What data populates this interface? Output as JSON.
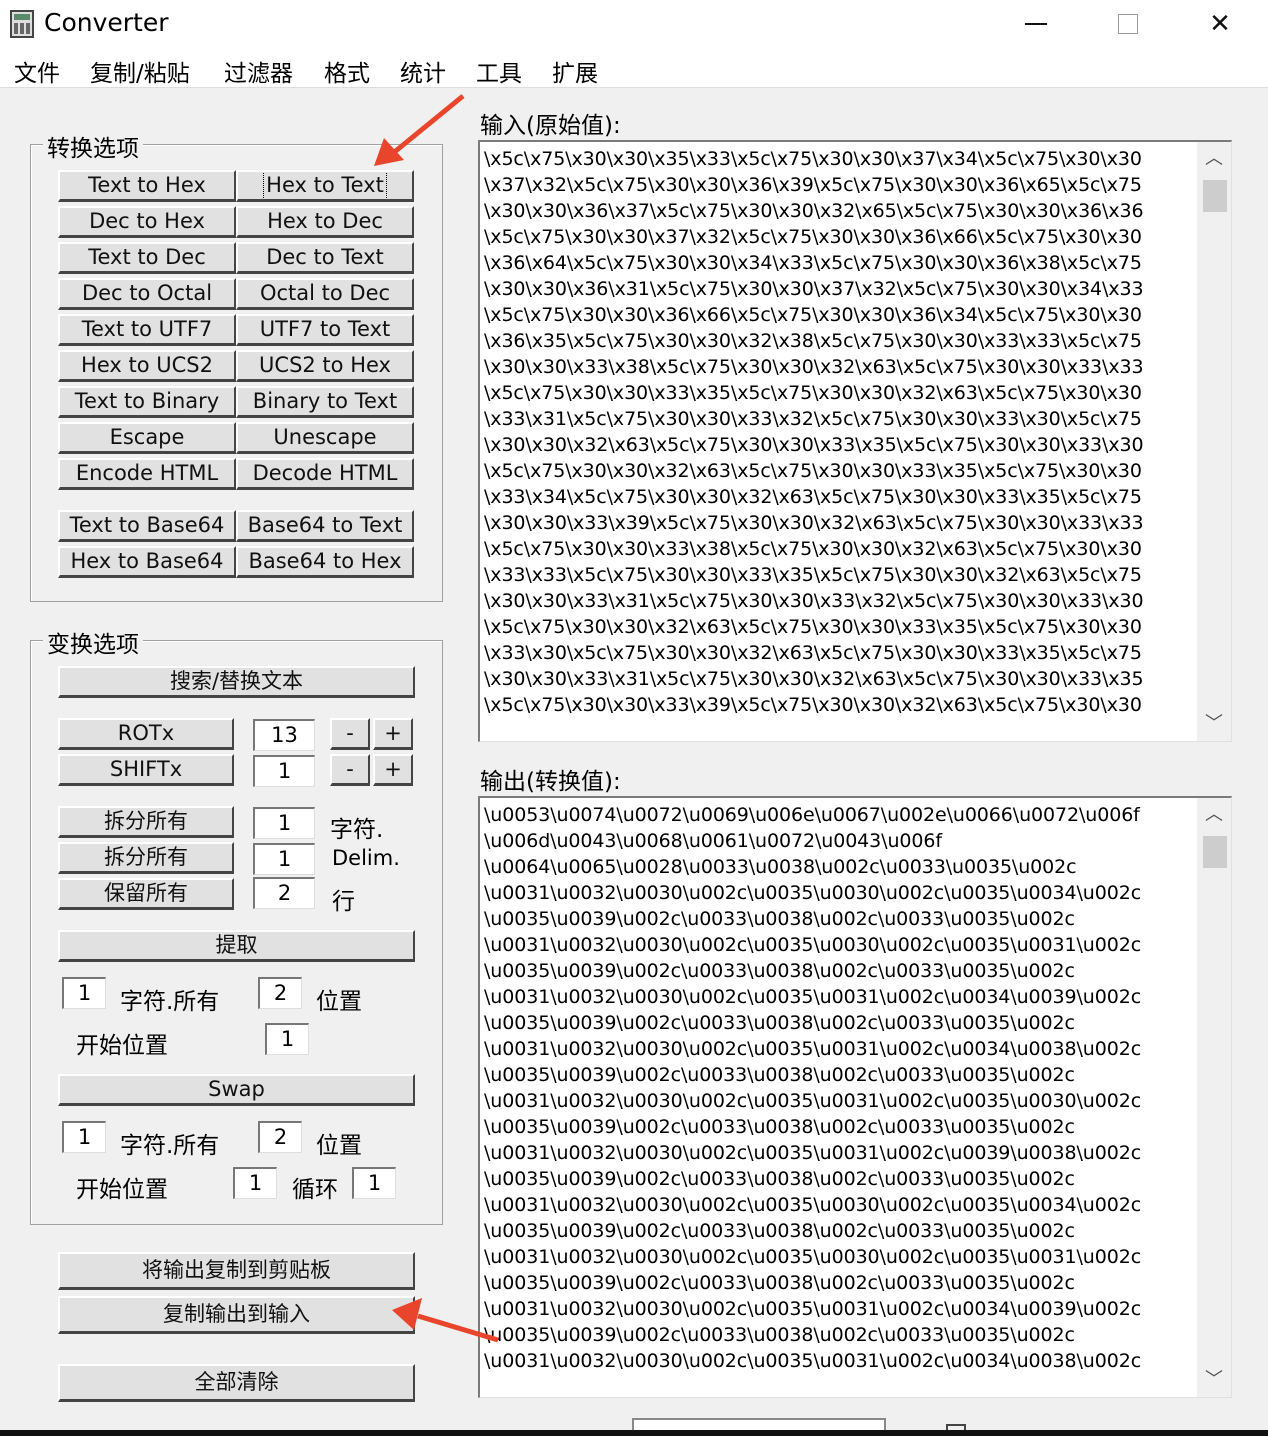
{
  "window": {
    "title": "Converter"
  },
  "menu": [
    "文件",
    "复制/粘贴",
    "过滤器",
    "格式",
    "统计",
    "工具",
    "扩展"
  ],
  "convert_group": {
    "title": "转换选项",
    "buttons": [
      "Text to Hex",
      "Hex to Text",
      "Dec to Hex",
      "Hex to Dec",
      "Text to Dec",
      "Dec to Text",
      "Dec to Octal",
      "Octal to Dec",
      "Text to UTF7",
      "UTF7 to Text",
      "Hex to UCS2",
      "UCS2 to Hex",
      "Text to Binary",
      "Binary to Text",
      "Escape",
      "Unescape",
      "Encode HTML",
      "Decode HTML",
      "Text to Base64",
      "Base64 to Text",
      "Hex to Base64",
      "Base64 to Hex"
    ]
  },
  "transform_group": {
    "title": "变换选项",
    "search_replace": "搜索/替换文本",
    "rotx_label": "ROTx",
    "rotx_value": "13",
    "shiftx_label": "SHIFTx",
    "shiftx_value": "1",
    "minus": "-",
    "plus": "+",
    "split_all_1": "拆分所有",
    "split_all_1_value": "1",
    "split_all_1_unit": "字符.",
    "split_all_2": "拆分所有",
    "split_all_2_value": "1",
    "split_all_2_unit": "Delim.",
    "keep_all": "保留所有",
    "keep_all_value": "2",
    "keep_all_unit": "行",
    "extract": "提取",
    "extract_chars": "1",
    "chars_all": "字符.所有",
    "extract_pos": "2",
    "position": "位置",
    "start_position": "开始位置",
    "extract_start": "1",
    "swap": "Swap",
    "swap_chars": "1",
    "swap_pos": "2",
    "swap_start": "1",
    "loop": "循环",
    "swap_loop": "1"
  },
  "actions": {
    "copy_output_clipboard": "将输出复制到剪贴板",
    "copy_output_input": "复制输出到输入",
    "clear_all": "全部清除"
  },
  "input": {
    "label": "输入(原始值):",
    "lines": [
      "\\x5c\\x75\\x30\\x30\\x35\\x33\\x5c\\x75\\x30\\x30\\x37\\x34\\x5c\\x75\\x30\\x30",
      "\\x37\\x32\\x5c\\x75\\x30\\x30\\x36\\x39\\x5c\\x75\\x30\\x30\\x36\\x65\\x5c\\x75",
      "\\x30\\x30\\x36\\x37\\x5c\\x75\\x30\\x30\\x32\\x65\\x5c\\x75\\x30\\x30\\x36\\x36",
      "\\x5c\\x75\\x30\\x30\\x37\\x32\\x5c\\x75\\x30\\x30\\x36\\x66\\x5c\\x75\\x30\\x30",
      "\\x36\\x64\\x5c\\x75\\x30\\x30\\x34\\x33\\x5c\\x75\\x30\\x30\\x36\\x38\\x5c\\x75",
      "\\x30\\x30\\x36\\x31\\x5c\\x75\\x30\\x30\\x37\\x32\\x5c\\x75\\x30\\x30\\x34\\x33",
      "\\x5c\\x75\\x30\\x30\\x36\\x66\\x5c\\x75\\x30\\x30\\x36\\x34\\x5c\\x75\\x30\\x30",
      "\\x36\\x35\\x5c\\x75\\x30\\x30\\x32\\x38\\x5c\\x75\\x30\\x30\\x33\\x33\\x5c\\x75",
      "\\x30\\x30\\x33\\x38\\x5c\\x75\\x30\\x30\\x32\\x63\\x5c\\x75\\x30\\x30\\x33\\x33",
      "\\x5c\\x75\\x30\\x30\\x33\\x35\\x5c\\x75\\x30\\x30\\x32\\x63\\x5c\\x75\\x30\\x30",
      "\\x33\\x31\\x5c\\x75\\x30\\x30\\x33\\x32\\x5c\\x75\\x30\\x30\\x33\\x30\\x5c\\x75",
      "\\x30\\x30\\x32\\x63\\x5c\\x75\\x30\\x30\\x33\\x35\\x5c\\x75\\x30\\x30\\x33\\x30",
      "\\x5c\\x75\\x30\\x30\\x32\\x63\\x5c\\x75\\x30\\x30\\x33\\x35\\x5c\\x75\\x30\\x30",
      "\\x33\\x34\\x5c\\x75\\x30\\x30\\x32\\x63\\x5c\\x75\\x30\\x30\\x33\\x35\\x5c\\x75",
      "\\x30\\x30\\x33\\x39\\x5c\\x75\\x30\\x30\\x32\\x63\\x5c\\x75\\x30\\x30\\x33\\x33",
      "\\x5c\\x75\\x30\\x30\\x33\\x38\\x5c\\x75\\x30\\x30\\x32\\x63\\x5c\\x75\\x30\\x30",
      "\\x33\\x33\\x5c\\x75\\x30\\x30\\x33\\x35\\x5c\\x75\\x30\\x30\\x32\\x63\\x5c\\x75",
      "\\x30\\x30\\x33\\x31\\x5c\\x75\\x30\\x30\\x33\\x32\\x5c\\x75\\x30\\x30\\x33\\x30",
      "\\x5c\\x75\\x30\\x30\\x32\\x63\\x5c\\x75\\x30\\x30\\x33\\x35\\x5c\\x75\\x30\\x30",
      "\\x33\\x30\\x5c\\x75\\x30\\x30\\x32\\x63\\x5c\\x75\\x30\\x30\\x33\\x35\\x5c\\x75",
      "\\x30\\x30\\x33\\x31\\x5c\\x75\\x30\\x30\\x32\\x63\\x5c\\x75\\x30\\x30\\x33\\x35",
      "\\x5c\\x75\\x30\\x30\\x33\\x39\\x5c\\x75\\x30\\x30\\x32\\x63\\x5c\\x75\\x30\\x30"
    ]
  },
  "output": {
    "label": "输出(转换值):",
    "lines": [
      "\\u0053\\u0074\\u0072\\u0069\\u006e\\u0067\\u002e\\u0066\\u0072\\u006f",
      "\\u006d\\u0043\\u0068\\u0061\\u0072\\u0043\\u006f",
      "\\u0064\\u0065\\u0028\\u0033\\u0038\\u002c\\u0033\\u0035\\u002c",
      "\\u0031\\u0032\\u0030\\u002c\\u0035\\u0030\\u002c\\u0035\\u0034\\u002c",
      "\\u0035\\u0039\\u002c\\u0033\\u0038\\u002c\\u0033\\u0035\\u002c",
      "\\u0031\\u0032\\u0030\\u002c\\u0035\\u0030\\u002c\\u0035\\u0031\\u002c",
      "\\u0035\\u0039\\u002c\\u0033\\u0038\\u002c\\u0033\\u0035\\u002c",
      "\\u0031\\u0032\\u0030\\u002c\\u0035\\u0031\\u002c\\u0034\\u0039\\u002c",
      "\\u0035\\u0039\\u002c\\u0033\\u0038\\u002c\\u0033\\u0035\\u002c",
      "\\u0031\\u0032\\u0030\\u002c\\u0035\\u0031\\u002c\\u0034\\u0038\\u002c",
      "\\u0035\\u0039\\u002c\\u0033\\u0038\\u002c\\u0033\\u0035\\u002c",
      "\\u0031\\u0032\\u0030\\u002c\\u0035\\u0031\\u002c\\u0035\\u0030\\u002c",
      "\\u0035\\u0039\\u002c\\u0033\\u0038\\u002c\\u0033\\u0035\\u002c",
      "\\u0031\\u0032\\u0030\\u002c\\u0035\\u0031\\u002c\\u0039\\u0038\\u002c",
      "\\u0035\\u0039\\u002c\\u0033\\u0038\\u002c\\u0033\\u0035\\u002c",
      "\\u0031\\u0032\\u0030\\u002c\\u0035\\u0030\\u002c\\u0035\\u0034\\u002c",
      "\\u0035\\u0039\\u002c\\u0033\\u0038\\u002c\\u0033\\u0035\\u002c",
      "\\u0031\\u0032\\u0030\\u002c\\u0035\\u0030\\u002c\\u0035\\u0031\\u002c",
      "\\u0035\\u0039\\u002c\\u0033\\u0038\\u002c\\u0033\\u0035\\u002c",
      "\\u0031\\u0032\\u0030\\u002c\\u0035\\u0031\\u002c\\u0034\\u0039\\u002c",
      "\\u0035\\u0039\\u002c\\u0033\\u0038\\u002c\\u0033\\u0035\\u002c",
      "\\u0031\\u0032\\u0030\\u002c\\u0035\\u0031\\u002c\\u0034\\u0038\\u002c"
    ]
  },
  "annotation_color": "#e8452c"
}
